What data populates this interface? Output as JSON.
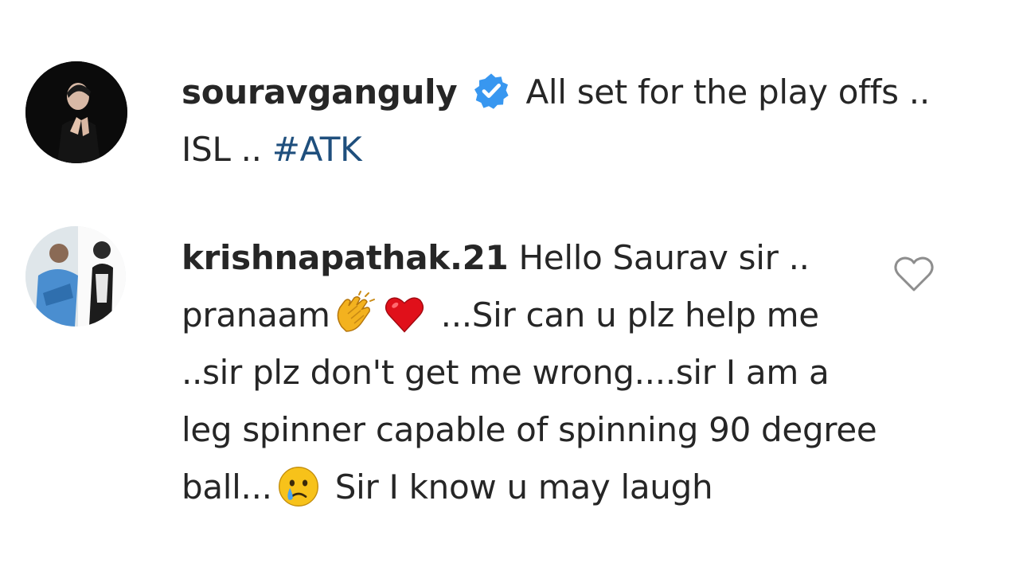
{
  "post": {
    "username": "souravganguly",
    "verified_icon": "verified-badge-icon",
    "caption": "All set for the play offs .. ISL .. ",
    "hashtag": "#ATK"
  },
  "comment": {
    "username": "krishnapathak.21",
    "text_part1": "Hello Saurav sir .. pranaam",
    "emoji_1": "clapping-hands-icon",
    "emoji_2": "red-heart-icon",
    "text_part2": "...Sir can u plz help me ..sir plz don't get me wrong....sir I am a leg spinner capable of spinning 90 degree ball...",
    "emoji_3": "crying-face-icon",
    "text_part3": "Sir I know u may laugh"
  },
  "like_icon": "heart-outline-icon",
  "colors": {
    "text": "#262626",
    "hashtag": "#1f4f7d",
    "verified": "#3897f0",
    "like_stroke": "#8e8e8e"
  }
}
